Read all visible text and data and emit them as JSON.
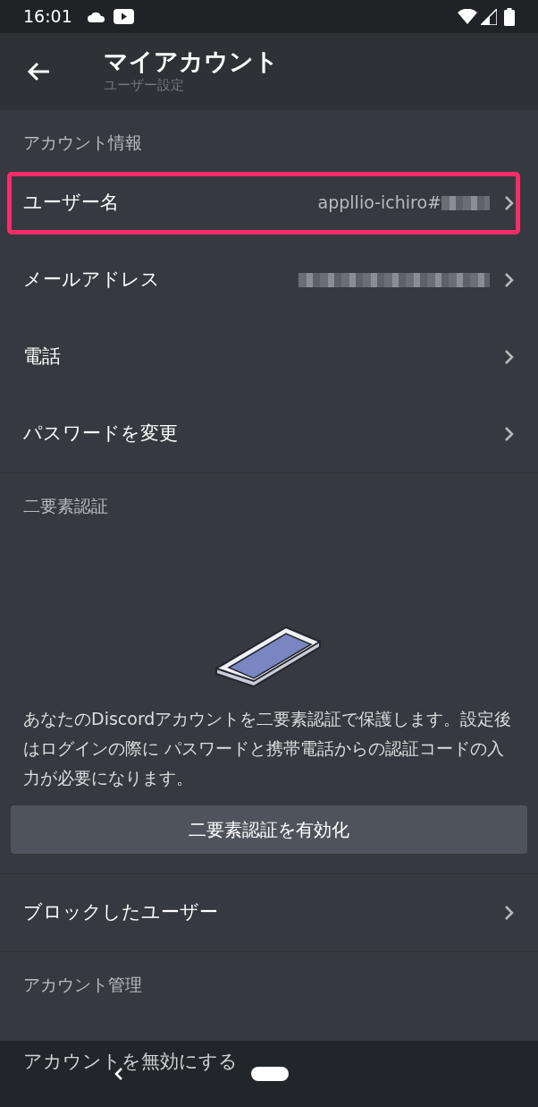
{
  "status_bar": {
    "time": "16:01"
  },
  "header": {
    "title": "マイアカウント",
    "subtitle": "ユーザー設定"
  },
  "sections": [
    {
      "kind": "list",
      "title": "アカウント情報",
      "rows": [
        {
          "label": "ユーザー名",
          "value": "appllio-ichiro#",
          "value_redacted": true,
          "highlighted": true
        },
        {
          "label": "メールアドレス",
          "value_redacted": true,
          "highlighted": false
        },
        {
          "label": "電話",
          "value_redacted": false,
          "highlighted": false
        },
        {
          "label": "パスワードを変更",
          "value_redacted": false,
          "highlighted": false
        }
      ]
    },
    {
      "kind": "twofactor",
      "title": "二要素認証",
      "description": "あなたのDiscordアカウントを二要素認証で保護します。設定後はログインの際に パスワードと携帯電話からの認証コードの入力が必要になります。",
      "button": "二要素認証を有効化"
    },
    {
      "kind": "list",
      "rows": [
        {
          "label": "ブロックしたユーザー",
          "value_redacted": false,
          "highlighted": false
        }
      ]
    },
    {
      "kind": "list",
      "title": "アカウント管理",
      "rows": [
        {
          "label": "アカウントを無効にする",
          "value_redacted": false,
          "highlighted": false
        }
      ]
    }
  ]
}
